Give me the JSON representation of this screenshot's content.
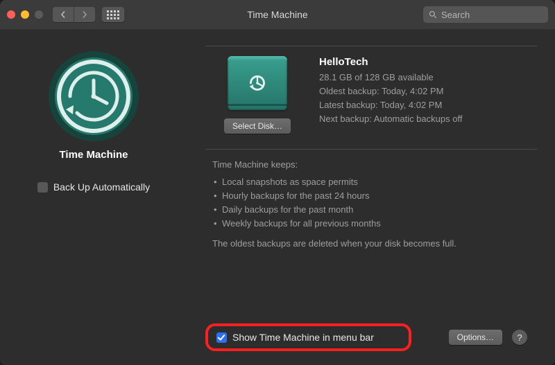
{
  "window": {
    "title": "Time Machine"
  },
  "search": {
    "placeholder": "Search"
  },
  "sidebar": {
    "appName": "Time Machine",
    "autoBackupLabel": "Back Up Automatically"
  },
  "disk": {
    "selectButton": "Select Disk…",
    "name": "HelloTech",
    "space": "28.1 GB of 128 GB available",
    "oldest": "Oldest backup: Today, 4:02 PM",
    "latest": "Latest backup: Today, 4:02 PM",
    "next": "Next backup: Automatic backups off"
  },
  "keeps": {
    "heading": "Time Machine keeps:",
    "bullets": [
      "Local snapshots as space permits",
      "Hourly backups for the past 24 hours",
      "Daily backups for the past month",
      "Weekly backups for all previous months"
    ],
    "note": "The oldest backups are deleted when your disk becomes full."
  },
  "footer": {
    "showMenuBar": "Show Time Machine in menu bar",
    "options": "Options…",
    "help": "?"
  }
}
